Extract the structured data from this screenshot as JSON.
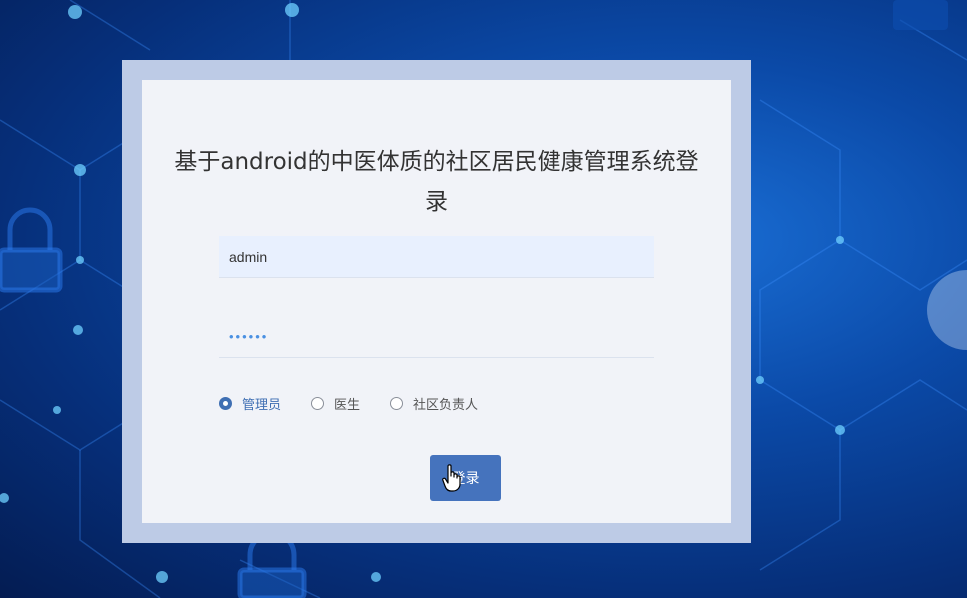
{
  "login": {
    "title": "基于android的中医体质的社区居民健康管理系统登录",
    "username_value": "admin",
    "password_value": "••••••",
    "roles": [
      {
        "label": "管理员",
        "checked": true
      },
      {
        "label": "医生",
        "checked": false
      },
      {
        "label": "社区负责人",
        "checked": false
      }
    ],
    "login_button": "登录"
  },
  "colors": {
    "accent": "#4573bd",
    "background": "#0b4aa8"
  },
  "icons": {
    "cursor": "hand-pointer-icon",
    "background_locks": "padlock-icon"
  }
}
